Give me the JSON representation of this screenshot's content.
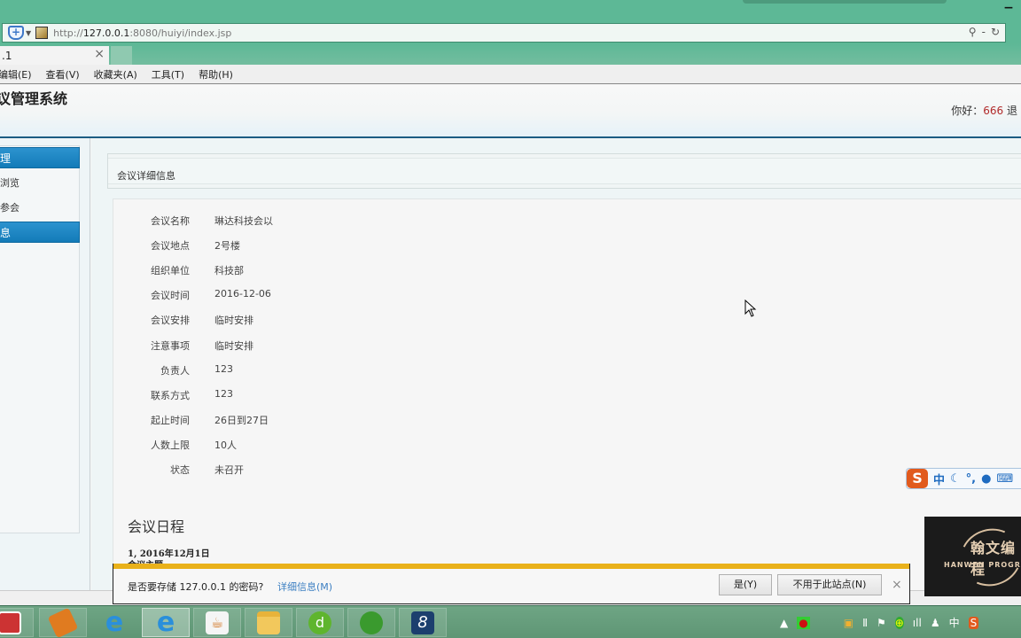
{
  "browser": {
    "url_prefix": "http://",
    "url_host": "127.0.0.1",
    "url_rest": ":8080/huiyi/index.jsp",
    "tab_title": ".1",
    "tab_close": "×",
    "search_icon": "⚲",
    "refresh_icon": "↻",
    "minimize": "−",
    "menu": [
      "编辑(E)",
      "查看(V)",
      "收藏夹(A)",
      "工具(T)",
      "帮助(H)"
    ]
  },
  "header": {
    "title": "议管理系统",
    "greeting_label": "你好：",
    "username": "666",
    "trailing": "退"
  },
  "sidebar": {
    "sections": [
      {
        "label": "理",
        "items": [
          "浏览",
          "参会"
        ]
      },
      {
        "label": "息",
        "items": []
      }
    ]
  },
  "breadcrumb": "会议详细信息",
  "meeting": {
    "fields": [
      {
        "label": "会议名称",
        "value": "琳达科技会以"
      },
      {
        "label": "会议地点",
        "value": "2号楼"
      },
      {
        "label": "组织单位",
        "value": "科技部"
      },
      {
        "label": "会议时间",
        "value": "2016-12-06"
      },
      {
        "label": "会议安排",
        "value": "临时安排"
      },
      {
        "label": "注意事项",
        "value": "临时安排"
      },
      {
        "label": "负责人",
        "value": "123"
      },
      {
        "label": "联系方式",
        "value": "123"
      },
      {
        "label": "起止时间",
        "value": "26日到27日"
      },
      {
        "label": "人数上限",
        "value": "10人"
      },
      {
        "label": "状态",
        "value": "未召开"
      }
    ],
    "schedule_title": "会议日程",
    "schedule_entry": "1, 2016年12月1日",
    "schedule_topic": "会议主题"
  },
  "password_prompt": {
    "message": "是否要存储 127.0.0.1 的密码?",
    "details_link": "详细信息(M)",
    "yes_button": "是(Y)",
    "never_button": "不用于此站点(N)",
    "close": "×"
  },
  "ime": {
    "logo": "S",
    "mode": "中",
    "icons": [
      "☾",
      "°,",
      "🎤",
      "⌨"
    ]
  },
  "watermark": {
    "cn": "翰文编程",
    "en": "HANWEN PROGRAM"
  },
  "taskbar": {
    "apps": [
      "notepad-plus",
      "book-app",
      "internet-explorer",
      "internet-explorer-active",
      "java",
      "file-explorer",
      "dreamweaver",
      "paw-app",
      "eclipse-app"
    ],
    "tray": [
      "▲",
      "●",
      "▣",
      "Ⅱ",
      "⚑",
      "⊕",
      "ıll",
      "♟",
      "中",
      "S"
    ]
  }
}
